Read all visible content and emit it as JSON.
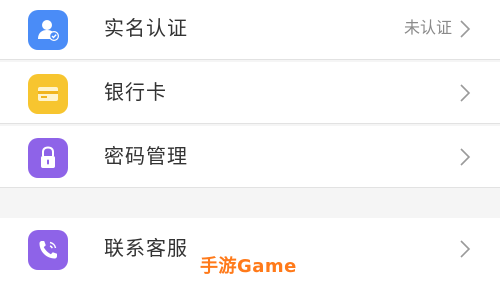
{
  "menu": {
    "items": [
      {
        "label": "实名认证",
        "status": "未认证",
        "icon": "person-verified-icon",
        "color": "#4a8cf7"
      },
      {
        "label": "银行卡",
        "status": "",
        "icon": "bank-card-icon",
        "color": "#f7c52f"
      },
      {
        "label": "密码管理",
        "status": "",
        "icon": "lock-icon",
        "color": "#8e63e8"
      },
      {
        "label": "联系客服",
        "status": "",
        "icon": "phone-icon",
        "color": "#8e63e8"
      }
    ]
  },
  "watermark": {
    "text": "手游Game"
  }
}
